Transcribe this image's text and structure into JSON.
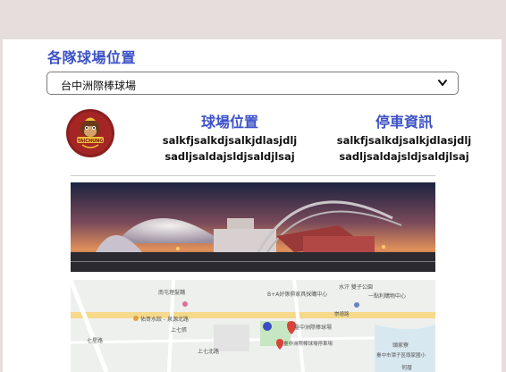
{
  "section": {
    "title": "各隊球場位置"
  },
  "venue_select": {
    "selected": "台中洲際棒球場"
  },
  "team_logo": {
    "text": "TAICHUNG"
  },
  "stadium_info": {
    "title": "球場位置",
    "line1": "salkfjsalkdjsalkjdlasjdlj",
    "line2": "sadljsaldajsldjsaldjlsaj"
  },
  "parking_info": {
    "title": "停車資訊",
    "line1": "salkfjsalkdjsalkjdlasjdlj",
    "line2": "sadljsaldajsldjsaldjlsaj"
  },
  "map": {
    "labels": {
      "furniture": "B+A好傢俱家具採購中心",
      "restaurant": "佑哥水餃 - 泉源北路",
      "barber": "南屯理髮舖",
      "road_xiang": "七星路",
      "cafe": "大好咖啡",
      "water_park": "水汗 雙子公園",
      "metro": "捷運文心崇德站",
      "market": "上七張",
      "stadium": "臺中洲際棒球場",
      "parking": "臺中洲際棒球場停車場",
      "road_1": "崇德路",
      "north_road": "上七北路",
      "eight_st": "十八街",
      "shop": "一點利購物中心",
      "shop2": "臺中市潭子區頭家國小",
      "field": "頭家寮",
      "school": "何厝"
    }
  }
}
